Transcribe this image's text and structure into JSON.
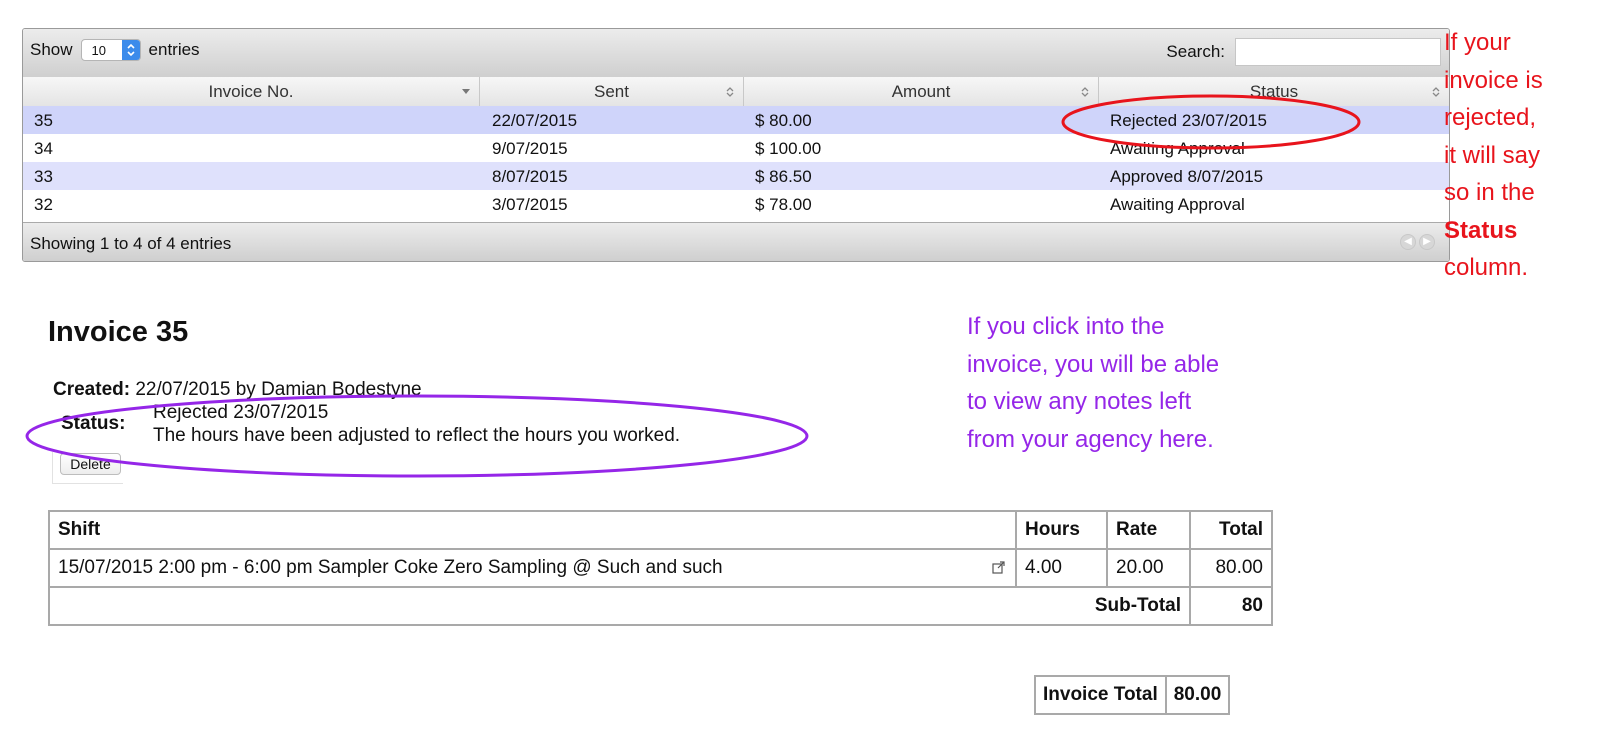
{
  "table_widget": {
    "show_label": "Show",
    "length_value": "10",
    "entries_label": "entries",
    "search_label": "Search:",
    "search_value": "",
    "columns": [
      "Invoice No.",
      "Sent",
      "Amount",
      "Status"
    ],
    "rows": [
      {
        "invoice_no": "35",
        "sent": "22/07/2015",
        "amount": "$ 80.00",
        "status": "Rejected 23/07/2015"
      },
      {
        "invoice_no": "34",
        "sent": "9/07/2015",
        "amount": "$ 100.00",
        "status": "Awaiting Approval"
      },
      {
        "invoice_no": "33",
        "sent": "8/07/2015",
        "amount": "$ 86.50",
        "status": "Approved 8/07/2015"
      },
      {
        "invoice_no": "32",
        "sent": "3/07/2015",
        "amount": "$ 78.00",
        "status": "Awaiting Approval"
      }
    ],
    "footer_info": "Showing 1 to 4 of 4 entries"
  },
  "annotations": {
    "red_note": [
      "If your",
      "invoice is",
      "rejected,",
      "it will say",
      "so in the"
    ],
    "red_note_bold": "Status",
    "red_note_end": "column.",
    "purple_note": [
      "If you click into the",
      "invoice, you will be able",
      "to view any notes left",
      "from your agency here."
    ],
    "colors": {
      "red": "#e8141c",
      "purple": "#9526e8"
    }
  },
  "invoice": {
    "title": "Invoice 35",
    "created_label": "Created:",
    "created_value": "22/07/2015 by Damian Bodestyne",
    "status_label": "Status:",
    "status_line1": "Rejected 23/07/2015",
    "status_line2": "The hours have been adjusted to reflect the hours you worked.",
    "delete_label": "Delete",
    "shift_headers": {
      "shift": "Shift",
      "hours": "Hours",
      "rate": "Rate",
      "total": "Total"
    },
    "shifts": [
      {
        "shift": "15/07/2015 2:00 pm - 6:00 pm Sampler Coke Zero Sampling @ Such and such",
        "hours": "4.00",
        "rate": "20.00",
        "total": "80.00"
      }
    ],
    "subtotal_label": "Sub-Total",
    "subtotal_value": "80",
    "invoice_total_label": "Invoice Total",
    "invoice_total_value": "80.00"
  },
  "icons": {
    "select_arrows": "updown-chevron-icon",
    "sort_desc": "sort-desc-icon",
    "sort_both": "sort-both-icon",
    "external_link": "external-link-icon",
    "pager_prev": "previous-page-icon",
    "pager_next": "next-page-icon"
  }
}
